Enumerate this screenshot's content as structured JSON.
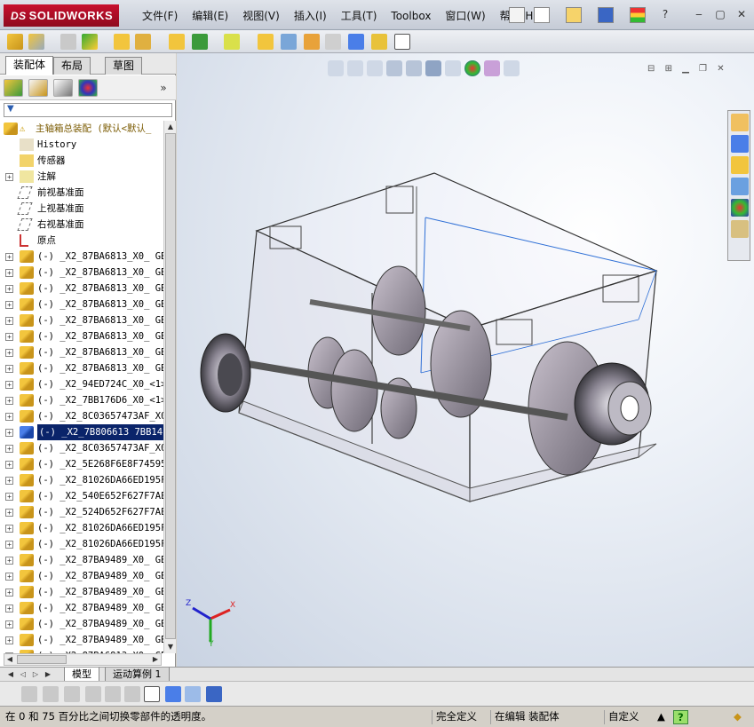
{
  "app": {
    "brand_ds": "DS",
    "brand_name": "SOLIDWORKS"
  },
  "menu": [
    "文件(F)",
    "编辑(E)",
    "视图(V)",
    "插入(I)",
    "工具(T)",
    "Toolbox",
    "窗口(W)",
    "帮助(H)"
  ],
  "panel_tabs": [
    "装配体",
    "布局",
    "草图"
  ],
  "tree": {
    "root": "主轴箱总装配  (默认<默认_",
    "items": [
      {
        "label": "History",
        "kind": "history"
      },
      {
        "label": "传感器",
        "kind": "sensor"
      },
      {
        "label": "注解",
        "kind": "annotation"
      },
      {
        "label": "前视基准面",
        "kind": "plane"
      },
      {
        "label": "上视基准面",
        "kind": "plane"
      },
      {
        "label": "右视基准面",
        "kind": "plane"
      },
      {
        "label": "原点",
        "kind": "origin"
      },
      {
        "label": "(-) _X2_87BA6813_X0_ GB",
        "kind": "part"
      },
      {
        "label": "(-) _X2_87BA6813_X0_ GB",
        "kind": "part"
      },
      {
        "label": "(-) _X2_87BA6813_X0_ GB",
        "kind": "part"
      },
      {
        "label": "(-) _X2_87BA6813_X0_ GB",
        "kind": "part"
      },
      {
        "label": "(-) _X2_87BA6813_X0_ GB",
        "kind": "part"
      },
      {
        "label": "(-) _X2_87BA6813_X0_ GB",
        "kind": "part"
      },
      {
        "label": "(-) _X2_87BA6813_X0_ GB",
        "kind": "part"
      },
      {
        "label": "(-) _X2_87BA6813_X0_ GB",
        "kind": "part"
      },
      {
        "label": "(-) _X2_94ED724C_X0_<1>",
        "kind": "part"
      },
      {
        "label": "(-) _X2_7BB176D6_X0_<1>",
        "kind": "part"
      },
      {
        "label": "(-) _X2_8C03657473AF_X0",
        "kind": "part"
      },
      {
        "label": "(-) _X2_7B806613 7BB14F5",
        "kind": "part",
        "selected": true
      },
      {
        "label": "(-) _X2_8C03657473AF_X0",
        "kind": "part"
      },
      {
        "label": "(-) _X2_5E268F6E8F74595",
        "kind": "part"
      },
      {
        "label": "(-) _X2_81026DA66ED195F",
        "kind": "part"
      },
      {
        "label": "(-) _X2_540E652F627F7AE",
        "kind": "part"
      },
      {
        "label": "(-) _X2_524D652F627F7AE",
        "kind": "part"
      },
      {
        "label": "(-) _X2_81026DA66ED195F",
        "kind": "part"
      },
      {
        "label": "(-) _X2_81026DA66ED195F",
        "kind": "part"
      },
      {
        "label": "(-) _X2_87BA9489_X0_ GB",
        "kind": "part"
      },
      {
        "label": "(-) _X2_87BA9489_X0_ GB",
        "kind": "part"
      },
      {
        "label": "(-) _X2_87BA9489_X0_ GB",
        "kind": "part"
      },
      {
        "label": "(-) _X2_87BA9489_X0_ GB",
        "kind": "part"
      },
      {
        "label": "(-) _X2_87BA9489_X0_ GB",
        "kind": "part"
      },
      {
        "label": "(-) _X2_87BA9489_X0_ GB",
        "kind": "part"
      },
      {
        "label": "(-) _X2_87BA6813_X0_ GB",
        "kind": "part"
      }
    ]
  },
  "bottom_tabs": [
    "模型",
    "运动算例 1"
  ],
  "triad": {
    "x": "X",
    "y": "Y",
    "z": "Z"
  },
  "status": {
    "hint": "在 0 和 75 百分比之间切换零部件的透明度。",
    "definition": "完全定义",
    "editing": "在编辑 装配体",
    "units": "自定义",
    "help": "?"
  }
}
